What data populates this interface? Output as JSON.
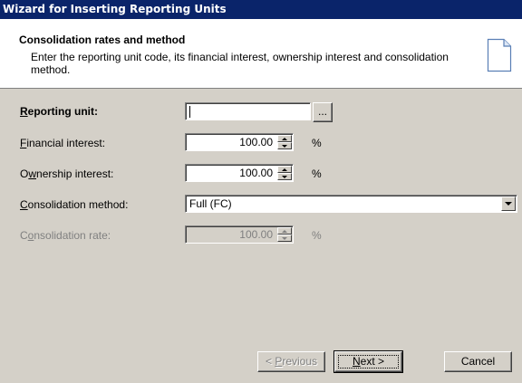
{
  "window": {
    "title": "Wizard for Inserting Reporting Units"
  },
  "header": {
    "title": "Consolidation rates and method",
    "subtitle": "Enter the reporting unit code, its financial interest, ownership interest and consolidation method."
  },
  "fields": {
    "reporting_unit": {
      "label_accel": "R",
      "label_rest": "eporting unit:",
      "value": "",
      "browse_label": "..."
    },
    "financial_interest": {
      "label_accel": "F",
      "label_rest": "inancial interest:",
      "value": "100.00",
      "unit": "%"
    },
    "ownership_interest": {
      "label_pre": "O",
      "label_accel": "w",
      "label_rest": "nership interest:",
      "value": "100.00",
      "unit": "%"
    },
    "consolidation_method": {
      "label_accel": "C",
      "label_rest": "onsolidation method:",
      "value": "Full (FC)"
    },
    "consolidation_rate": {
      "label_pre": "C",
      "label_accel": "o",
      "label_rest": "nsolidation rate:",
      "value": "100.00",
      "unit": "%"
    }
  },
  "buttons": {
    "previous": {
      "prefix": "< ",
      "accel": "P",
      "rest": "revious"
    },
    "next": {
      "accel": "N",
      "rest": "ext >"
    },
    "cancel": {
      "label": "Cancel"
    }
  },
  "icons": {
    "header_icon": "document-icon"
  },
  "colors": {
    "titlebar": "#0a246a",
    "dialog": "#d4d0c8",
    "header_bg": "#ffffff"
  }
}
